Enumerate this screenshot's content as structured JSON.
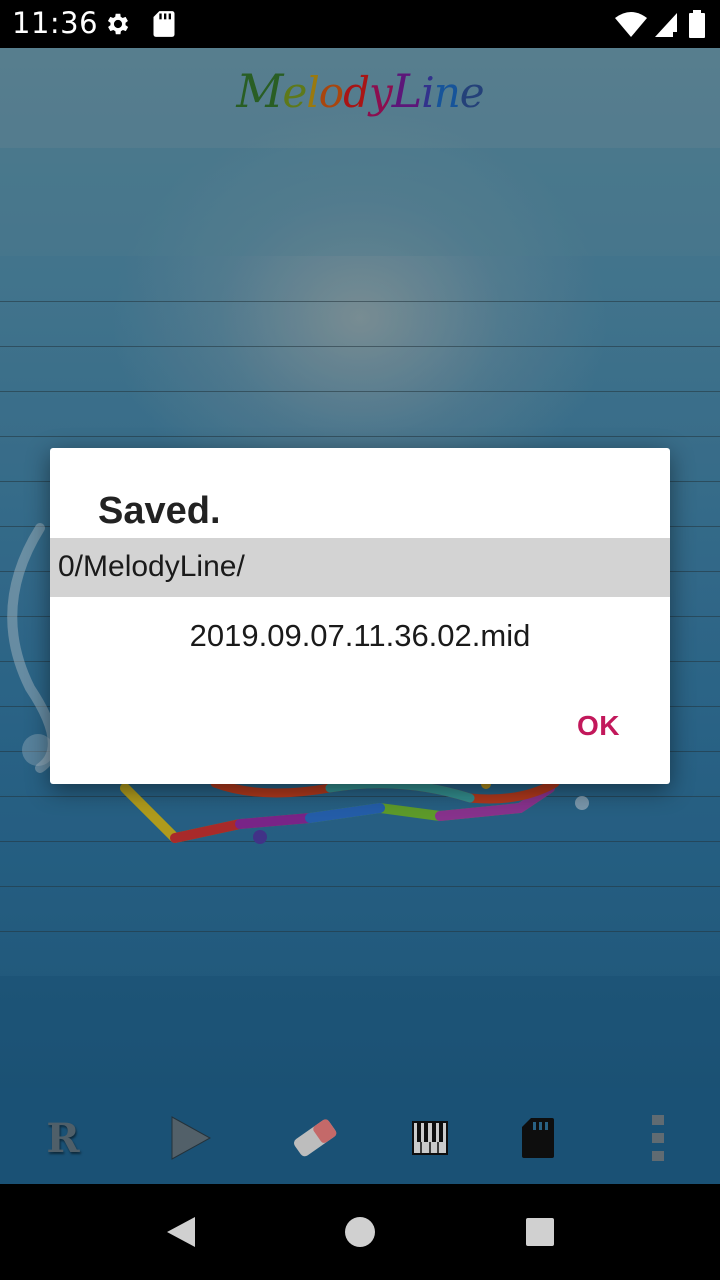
{
  "status_bar": {
    "time": "11:36",
    "icons": [
      "settings-icon",
      "sd-card-icon",
      "wifi-icon",
      "cellular-signal-icon",
      "battery-icon"
    ]
  },
  "app": {
    "logo_letters": [
      "M",
      "e",
      "l",
      "o",
      "d",
      "y",
      "L",
      "i",
      "n",
      "e"
    ],
    "logo_colors": [
      "#2f6b2a",
      "#6b8a1e",
      "#b08a10",
      "#c05010",
      "#c01818",
      "#a0105a",
      "#6a1a8a",
      "#3a3aa0",
      "#1a60b0",
      "#2a4a8a"
    ]
  },
  "dialog": {
    "title": "Saved.",
    "path": "0/MelodyLine/",
    "filename": "2019.09.07.11.36.02.mid",
    "ok_label": "OK",
    "accent_color": "#c2185b"
  },
  "toolbar": {
    "record_label": "R",
    "items": [
      "record-icon",
      "play-icon",
      "eraser-icon",
      "piano-icon",
      "sd-card-icon",
      "overflow-menu-icon"
    ]
  },
  "nav_bar": {
    "items": [
      "back-icon",
      "home-icon",
      "recents-icon"
    ]
  }
}
